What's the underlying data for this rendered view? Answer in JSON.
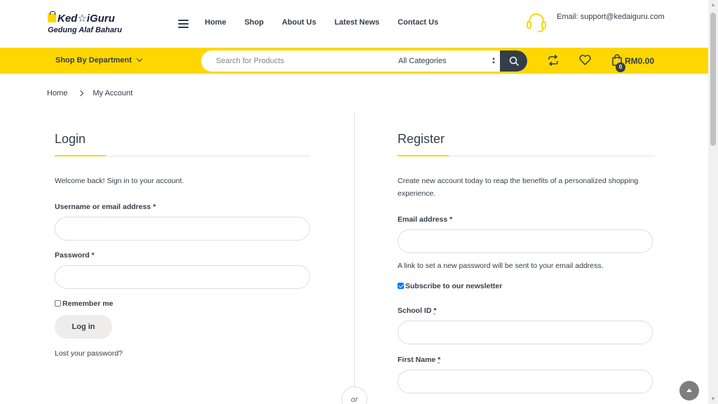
{
  "header": {
    "logo_text": "Ked☆iGuru",
    "logo_tagline": "Gedung Alaf Baharu",
    "nav": [
      "Home",
      "Shop",
      "About Us",
      "Latest News",
      "Contact Us"
    ],
    "support_email": "Email: support@kedaiguru.com"
  },
  "toolbar": {
    "department_label": "Shop By Department",
    "search_placeholder": "Search for Products",
    "category_selected": "All Categories",
    "cart_count": "0",
    "cart_total": "RM0.00",
    "accent_color": "#fed700",
    "dark_color": "#333e48"
  },
  "breadcrumb": {
    "home": "Home",
    "current": "My Account"
  },
  "login": {
    "title": "Login",
    "intro": "Welcome back! Sign in to your account.",
    "username_label": "Username or email address",
    "password_label": "Password",
    "required_mark": "*",
    "remember_label": "Remember me",
    "remember_checked": false,
    "submit_label": "Log in",
    "lost_password": "Lost your password?"
  },
  "divider_text": "or",
  "register": {
    "title": "Register",
    "intro": "Create new account today to reap the benefits of a personalized shopping experience.",
    "email_label": "Email address",
    "required_mark": "*",
    "password_note": "A link to set a new password will be sent to your email address.",
    "newsletter_label": "Subscribe to our newsletter",
    "newsletter_checked": true,
    "school_id_label": "School ID",
    "first_name_label": "First Name"
  }
}
